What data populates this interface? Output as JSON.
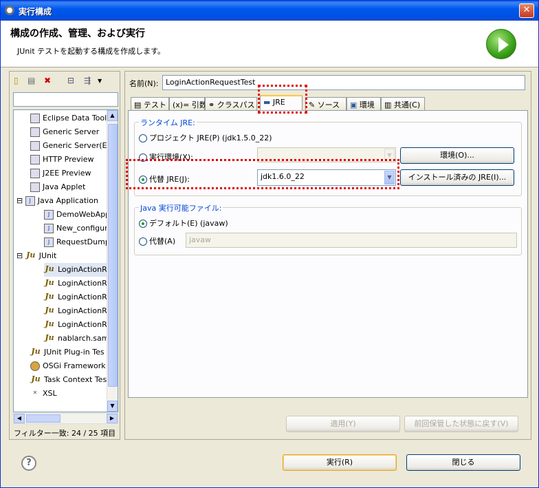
{
  "window": {
    "title": "実行構成",
    "close_label": "✕"
  },
  "banner": {
    "heading": "構成の作成、管理、および実行",
    "description": "JUnit テストを起動する構成を作成します。"
  },
  "tree": {
    "items": [
      {
        "label": "Eclipse Data Tool",
        "icon": "data-tool-icon"
      },
      {
        "label": "Generic Server",
        "icon": "server-icon"
      },
      {
        "label": "Generic Server(E",
        "icon": "server-icon"
      },
      {
        "label": "HTTP Preview",
        "icon": "server-icon"
      },
      {
        "label": "J2EE Preview",
        "icon": "server-icon"
      },
      {
        "label": "Java Applet",
        "icon": "applet-icon"
      },
      {
        "label": "Java Application",
        "icon": "java-app-icon"
      },
      {
        "label": "DemoWebApp",
        "icon": "java-app-icon"
      },
      {
        "label": "New_configur",
        "icon": "java-app-icon"
      },
      {
        "label": "RequestDump",
        "icon": "java-app-icon"
      },
      {
        "label": "JUnit",
        "icon": "junit-icon"
      },
      {
        "label": "LoginActionRe",
        "icon": "junit-icon"
      },
      {
        "label": "LoginActionRe",
        "icon": "junit-icon"
      },
      {
        "label": "LoginActionRe",
        "icon": "junit-icon"
      },
      {
        "label": "LoginActionRe",
        "icon": "junit-icon"
      },
      {
        "label": "LoginActionRe",
        "icon": "junit-icon"
      },
      {
        "label": "nablarch.sam",
        "icon": "junit-icon"
      },
      {
        "label": "JUnit Plug-in Tes",
        "icon": "junit-plugin-icon"
      },
      {
        "label": "OSGi Framework",
        "icon": "osgi-icon"
      },
      {
        "label": "Task Context Test",
        "icon": "junit-icon"
      },
      {
        "label": "XSL",
        "icon": "xsl-icon"
      }
    ],
    "filter_status": "フィルター一致: 24 / 25 項目"
  },
  "config": {
    "name_label": "名前(N):",
    "name_value": "LoginActionRequestTest",
    "tabs": [
      {
        "label": "テスト",
        "icon": "test-tab-icon"
      },
      {
        "label": "(x)= 引数",
        "icon": "args-tab-icon"
      },
      {
        "label": "クラスパス",
        "icon": "classpath-tab-icon"
      },
      {
        "label": "JRE",
        "icon": "jre-tab-icon"
      },
      {
        "label": "ソース",
        "icon": "source-tab-icon"
      },
      {
        "label": "環境",
        "icon": "env-tab-icon"
      },
      {
        "label": "共通(C)",
        "icon": "common-tab-icon"
      }
    ],
    "active_tab": "JRE"
  },
  "jre": {
    "group_label": "ランタイム JRE:",
    "project_jre_label": "プロジェクト JRE(P) (jdk1.5.0_22)",
    "exec_env_label": "実行環境(X):",
    "exec_env_value": "",
    "env_button": "環境(O)...",
    "alt_jre_label": "代替 JRE(J):",
    "alt_jre_value": "jdk1.6.0_22",
    "installed_jre_button": "インストール済みの JRE(I)...",
    "selected": "alternate"
  },
  "executable": {
    "group_label": "Java 実行可能ファイル:",
    "default_label": "デフォルト(E) (javaw)",
    "alt_label": "代替(A)",
    "alt_value": "javaw",
    "selected": "default"
  },
  "actions": {
    "apply": "適用(Y)",
    "revert": "前回保管した状態に戻す(V)",
    "run": "実行(R)",
    "close": "閉じる"
  },
  "colors": {
    "title_bar": "#0058ee",
    "highlight_border": "#e00000",
    "group_label": "#0046d5"
  }
}
